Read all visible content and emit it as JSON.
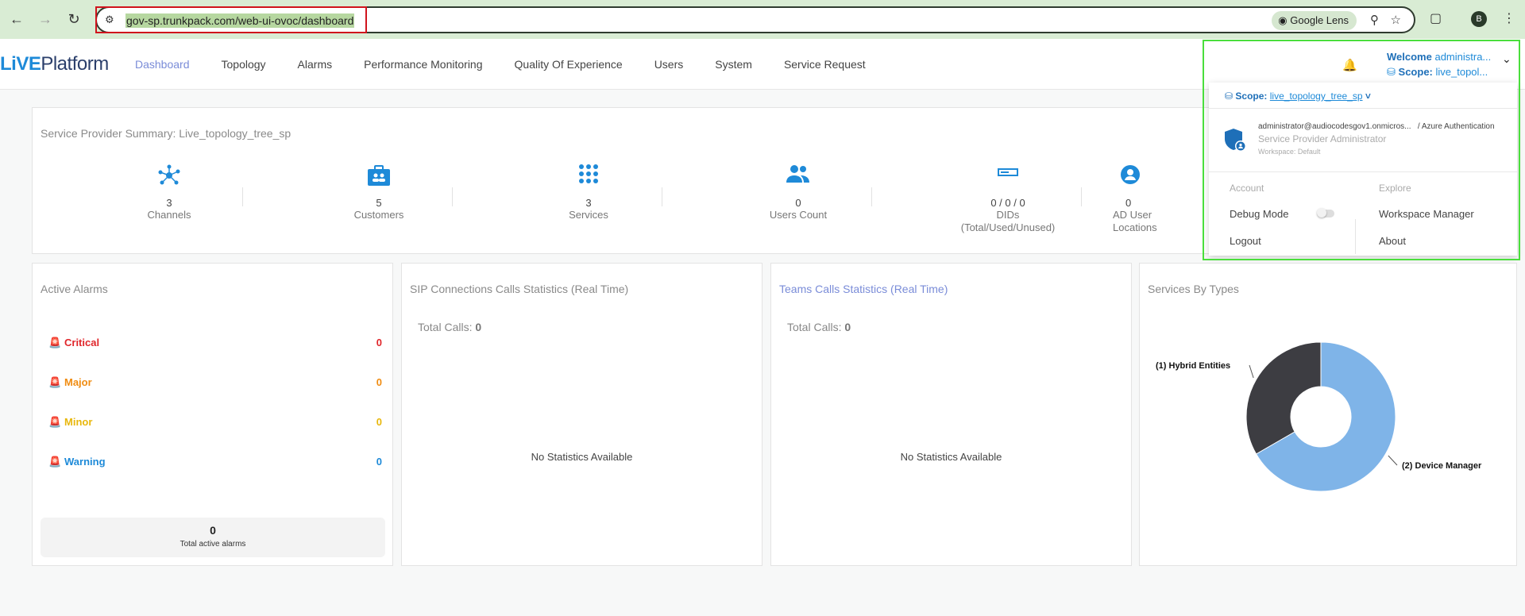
{
  "browser": {
    "url": "gov-sp.trunkpack.com/web-ui-ovoc/dashboard",
    "lens_label": "Google Lens",
    "avatar_letter": "B"
  },
  "app": {
    "logo_left": "LiVE",
    "logo_right": "Platform",
    "nav": [
      "Dashboard",
      "Topology",
      "Alarms",
      "Performance Monitoring",
      "Quality Of Experience",
      "Users",
      "System",
      "Service Request"
    ],
    "active_nav": "Dashboard"
  },
  "user_menu": {
    "welcome_label": "Welcome",
    "welcome_user": "administra...",
    "scope_label": "Scope:",
    "scope_short": "live_topol...",
    "scope_full": "live_topology_tree_sp",
    "email": "administrator@audiocodesgov1.onmicros...",
    "auth": "/ Azure Authentication",
    "role": "Service Provider Administrator",
    "workspace": "Workspace: Default",
    "account_title": "Account",
    "explore_title": "Explore",
    "debug_mode": "Debug Mode",
    "logout": "Logout",
    "workspace_manager": "Workspace Manager",
    "about": "About"
  },
  "summary": {
    "title": "Service Provider Summary: Live_topology_tree_sp",
    "stats": [
      {
        "icon": "channels-icon",
        "value": "3",
        "label": "Channels"
      },
      {
        "icon": "customers-icon",
        "value": "5",
        "label": "Customers"
      },
      {
        "icon": "services-icon",
        "value": "3",
        "label": "Services"
      },
      {
        "icon": "users-icon",
        "value": "0",
        "label": "Users Count"
      },
      {
        "icon": "dids-icon",
        "value": "0 / 0 / 0",
        "label": "DIDs",
        "label2": "(Total/Used/Unused)"
      },
      {
        "icon": "ad-users-icon",
        "value": "0",
        "label": "AD User",
        "label2": "Locations"
      }
    ]
  },
  "alarms": {
    "title": "Active Alarms",
    "rows": [
      {
        "label": "Critical",
        "count": "0",
        "color": "#e0262b"
      },
      {
        "label": "Major",
        "count": "0",
        "color": "#f08c12"
      },
      {
        "label": "Minor",
        "count": "0",
        "color": "#e8b70c"
      },
      {
        "label": "Warning",
        "count": "0",
        "color": "#1e8ad8"
      }
    ],
    "total_value": "0",
    "total_label": "Total active alarms"
  },
  "sip": {
    "title": "SIP Connections Calls Statistics (Real Time)",
    "total_label": "Total Calls:",
    "total_value": "0",
    "empty": "No Statistics Available"
  },
  "teams": {
    "title": "Teams Calls Statistics (Real Time)",
    "total_label": "Total Calls:",
    "total_value": "0",
    "empty": "No Statistics Available"
  },
  "services_chart": {
    "title": "Services By Types",
    "chart_data": {
      "type": "pie",
      "categories": [
        "Hybrid Entities",
        "Device Manager"
      ],
      "values": [
        1,
        2
      ],
      "labels": [
        "(1) Hybrid Entities",
        "(2) Device Manager"
      ],
      "colors": [
        "#3d3d42",
        "#7fb4e8"
      ]
    }
  }
}
